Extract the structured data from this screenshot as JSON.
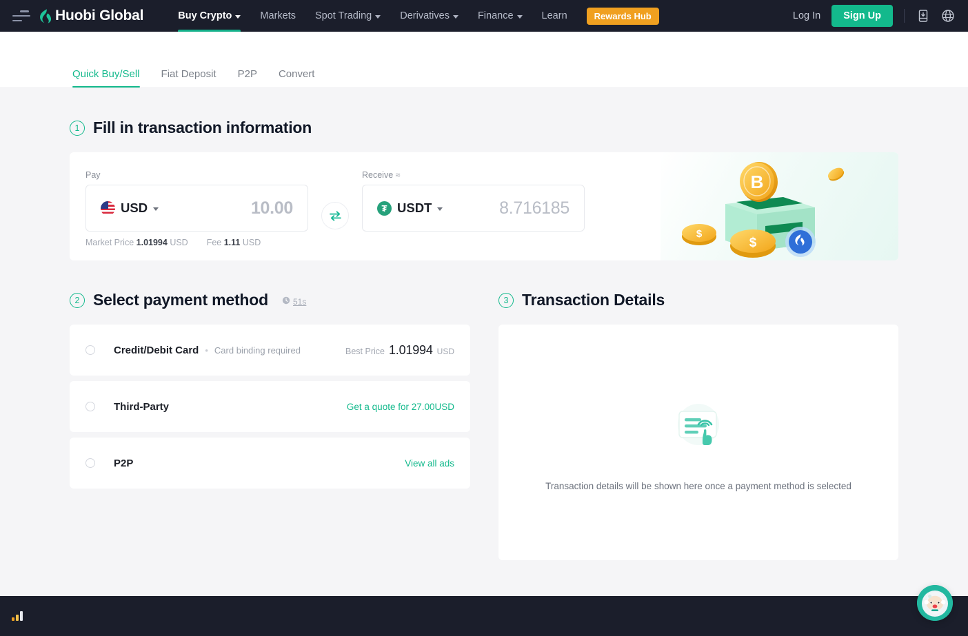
{
  "nav": {
    "menu_icon": "hamburger-menu-icon",
    "brand": "Huobi Global",
    "links": [
      {
        "label": "Buy Crypto",
        "caret": true,
        "active": true
      },
      {
        "label": "Markets",
        "caret": false,
        "active": false
      },
      {
        "label": "Spot Trading",
        "caret": true,
        "active": false
      },
      {
        "label": "Derivatives",
        "caret": true,
        "active": false
      },
      {
        "label": "Finance",
        "caret": true,
        "active": false
      },
      {
        "label": "Learn",
        "caret": false,
        "active": false
      }
    ],
    "rewards_label": "Rewards Hub",
    "login_label": "Log In",
    "signup_label": "Sign Up",
    "download_icon": "download-app-icon",
    "language_icon": "globe-language-icon"
  },
  "tabs": [
    {
      "label": "Quick Buy/Sell",
      "active": true
    },
    {
      "label": "Fiat Deposit",
      "active": false
    },
    {
      "label": "P2P",
      "active": false
    },
    {
      "label": "Convert",
      "active": false
    }
  ],
  "step1": {
    "number": "1",
    "title": "Fill in transaction information",
    "pay_label": "Pay",
    "pay_currency": "USD",
    "pay_amount": "10.00",
    "pay_flag_icon": "us-flag-icon",
    "receive_label": "Receive ≈",
    "receive_currency": "USDT",
    "receive_amount": "8.716185",
    "receive_icon": "usdt-tether-icon",
    "swap_icon": "swap-arrows-icon",
    "market_price_label": "Market Price",
    "market_price_value": "1.01994",
    "market_price_unit": "USD",
    "fee_label": "Fee",
    "fee_value": "1.11",
    "fee_unit": "USD",
    "illustration": "bitcoin-coin-deposit-box-illustration"
  },
  "step2": {
    "number": "2",
    "title": "Select payment method",
    "timer_icon": "clock-icon",
    "timer_text": "51s",
    "methods": [
      {
        "name": "Credit/Debit Card",
        "separator": "•",
        "subtitle": "Card binding required",
        "best_price_label": "Best Price",
        "best_price_value": "1.01994",
        "best_price_unit": "USD",
        "link": "",
        "selected": false
      },
      {
        "name": "Third-Party",
        "separator": "",
        "subtitle": "",
        "best_price_label": "",
        "best_price_value": "",
        "best_price_unit": "",
        "link": "Get a quote for 27.00USD",
        "selected": false
      },
      {
        "name": "P2P",
        "separator": "",
        "subtitle": "",
        "best_price_label": "",
        "best_price_value": "",
        "best_price_unit": "",
        "link": "View all ads",
        "selected": false
      }
    ]
  },
  "step3": {
    "number": "3",
    "title": "Transaction Details",
    "empty_illustration": "tap-card-empty-state-icon",
    "empty_text": "Transaction details will be shown here once a payment method is selected"
  },
  "footer": {
    "signal_icon": "signal-bars-icon"
  },
  "chat": {
    "icon": "customer-support-avatar-icon"
  },
  "colors": {
    "brand_teal": "#13b98c",
    "nav_bg": "#1b1e2b",
    "rewards_orange": "#f0a020",
    "page_bg": "#f5f5f7"
  }
}
